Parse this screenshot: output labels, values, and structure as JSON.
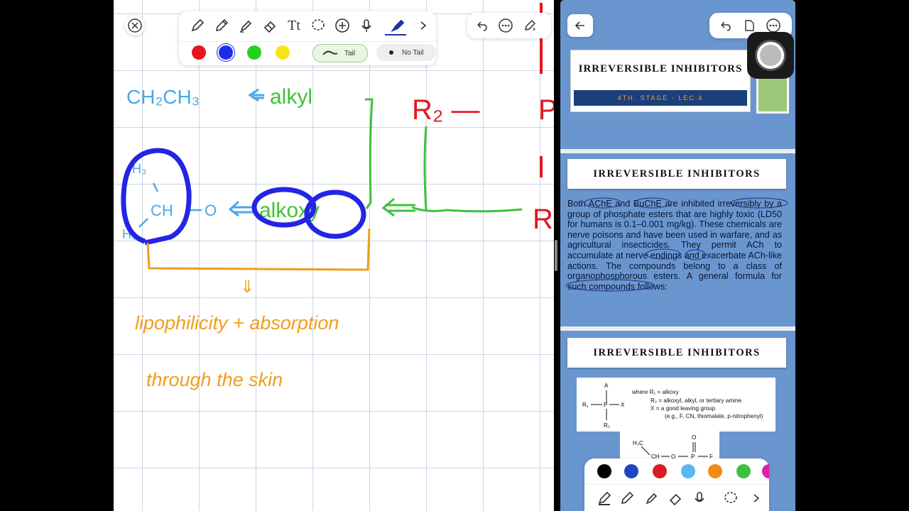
{
  "left_toolbar": {
    "tools": [
      "close-icon",
      "pen-icon",
      "pencil-icon",
      "highlighter-icon",
      "eraser-icon",
      "text-tool-icon",
      "lasso-icon",
      "add-icon",
      "microphone-icon",
      "marker-icon",
      "chevron-right-icon"
    ],
    "colors": [
      "#e8141c",
      "#1f2ee6",
      "#22d11e",
      "#f7e51a"
    ],
    "tail_label": "Tail",
    "notail_label": "No Tail",
    "right_actions": [
      "undo-icon",
      "more-icon",
      "edit-icon"
    ]
  },
  "handwriting": {
    "ch2ch3": "CH₂CH₃",
    "alkyl": "alkyl",
    "r2": "R₂ —",
    "p": "P",
    "r": "R",
    "ch3_top": "H₃",
    "ch": "CH",
    "ch3_bottom": "H₃",
    "o": "O",
    "alkoxy": "alkoxy",
    "down_arrow": "⇓",
    "line1": "lipophilicity + absorption",
    "line2": "through the skin"
  },
  "right_panel": {
    "slide1": {
      "title": "IRREVERSIBLE   INHIBITORS",
      "subtitle": "4TH. STAGE  -  LEC.4"
    },
    "slide2": {
      "title": "IRREVERSIBLE   INHIBITORS",
      "body": "Both AChE and BuChE are inhibited irreversibly by a group of phosphate esters that are highly toxic (LD50 for humans is 0.1–0.001 mg/kg). These chemicals are nerve poisons and have been used in warfare, and as agricultural insecticides. They permit ACh to accumulate at nerve endings and exacerbate ACh-like actions. The compounds belong to a class of organophosphorous esters. A general formula for such compounds follows:"
    },
    "slide3": {
      "title": "IRREVERSIBLE   INHIBITORS",
      "formula_where": "where R₁ = alkoxy",
      "formula_r2": "R₂ = alkoxyl, alkyl, or tertiary amine",
      "formula_x": "X = a good leaving group",
      "formula_eg": "(e.g., F, CN, thiomalate, p-nitrophenyl)",
      "struct_a": "A",
      "struct_r1": "R₁",
      "struct_p": "P",
      "struct_x": "X",
      "struct_r2": "R₂",
      "struct2_h3c": "H₃C",
      "struct2_ch": "CH",
      "struct2_o": "O",
      "struct2_p": "P",
      "struct2_f": "F",
      "struct2_o_top": "O"
    },
    "bottom_colors": [
      "#000000",
      "#1f45c4",
      "#d91c23",
      "#5ab8f0",
      "#f28c0f",
      "#3fbf3f",
      "#e01fa8"
    ],
    "bottom_tools": [
      "pen-icon",
      "pencil-icon",
      "highlighter-icon",
      "eraser-icon",
      "microphone-icon",
      "lasso-icon",
      "chevron-right-icon"
    ]
  }
}
